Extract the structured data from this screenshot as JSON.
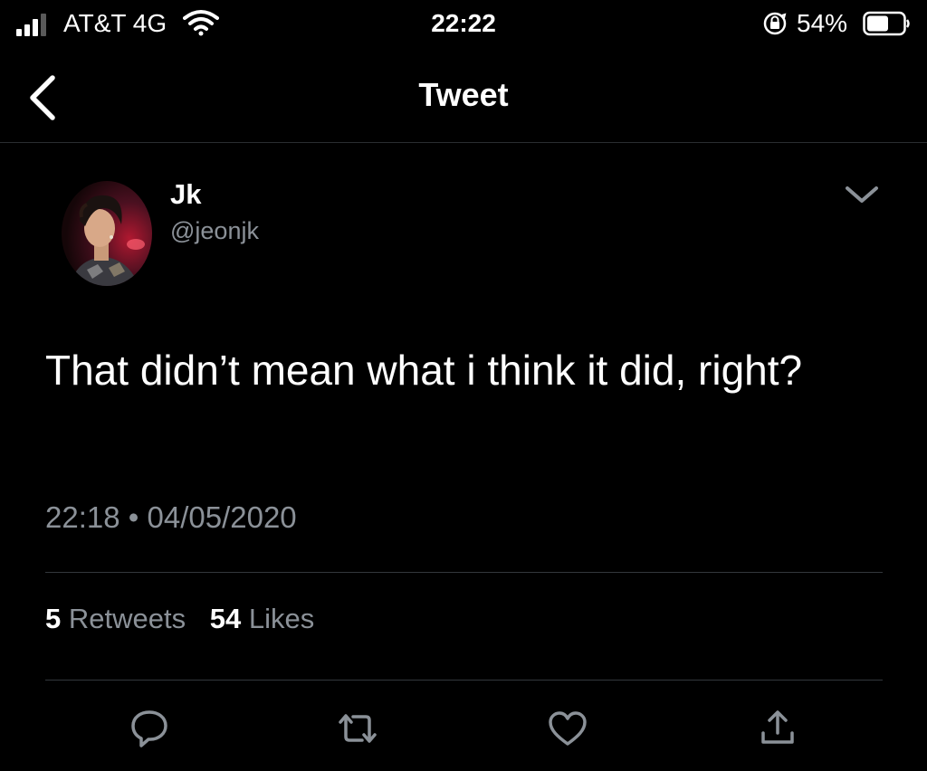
{
  "status_bar": {
    "carrier": "AT&T 4G",
    "time": "22:22",
    "battery_percent": "54%",
    "icons": [
      "signal-icon",
      "wifi-icon",
      "orientation-lock-icon",
      "battery-icon"
    ]
  },
  "nav": {
    "title": "Tweet",
    "back_icon": "chevron-left-icon"
  },
  "tweet": {
    "author": {
      "display_name": "Jk",
      "handle": "@jeonjk"
    },
    "text": "That didn’t mean what i think it did, right?",
    "time": "22:18",
    "separator": "•",
    "date": "04/05/2020",
    "stats": {
      "retweets_count": "5",
      "retweets_label": "Retweets",
      "likes_count": "54",
      "likes_label": "Likes"
    },
    "actions": [
      "reply-icon",
      "retweet-icon",
      "like-icon",
      "share-icon"
    ]
  },
  "colors": {
    "background": "#000000",
    "text_primary": "#ffffff",
    "text_secondary": "#8b9198",
    "divider": "#33373c"
  }
}
